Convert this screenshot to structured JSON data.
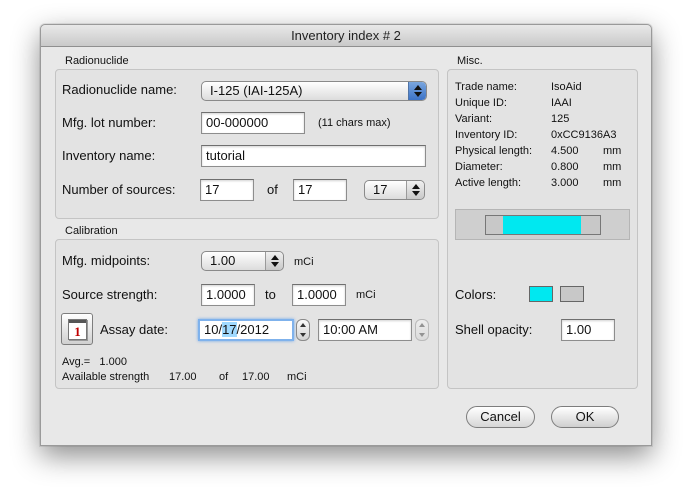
{
  "window": {
    "title": "Inventory index # 2"
  },
  "radionuclide": {
    "group_label": "Radionuclide",
    "name_label": "Radionuclide name:",
    "name_value": "I-125 (IAI-125A)",
    "lot_label": "Mfg. lot number:",
    "lot_value": "00-000000",
    "lot_hint": "(11 chars max)",
    "inventory_label": "Inventory name:",
    "inventory_value": "tutorial",
    "sources_label": "Number of sources:",
    "sources_value": "17",
    "of_label": "of",
    "sources_total": "17",
    "sources_popup": "17"
  },
  "calibration": {
    "group_label": "Calibration",
    "midpoints_label": "Mfg. midpoints:",
    "midpoints_value": "1.00",
    "midpoints_unit": "mCi",
    "strength_label": "Source strength:",
    "strength_from": "1.0000",
    "to_label": "to",
    "strength_to": "1.0000",
    "strength_unit": "mCi",
    "calendar_day": "1",
    "assay_label": "Assay date:",
    "date_month": "10/",
    "date_day": "17",
    "date_year": "/2012",
    "time_value": "10:00 AM",
    "avg_line": "Avg.=   1.000",
    "available_label": "Available strength",
    "available_value": "17.00",
    "available_of": "of",
    "available_total": "17.00",
    "available_unit": "mCi"
  },
  "misc": {
    "group_label": "Misc.",
    "rows": [
      {
        "label": "Trade name:",
        "value": "IsoAid",
        "unit": ""
      },
      {
        "label": "Unique ID:",
        "value": "IAAI",
        "unit": ""
      },
      {
        "label": "Variant:",
        "value": "125",
        "unit": ""
      },
      {
        "label": "Inventory ID:",
        "value": "0xCC9136A3",
        "unit": ""
      },
      {
        "label": "Physical length:",
        "value": "4.500",
        "unit": "mm"
      },
      {
        "label": "Diameter:",
        "value": "0.800",
        "unit": "mm"
      },
      {
        "label": "Active length:",
        "value": "3.000",
        "unit": "mm"
      }
    ],
    "colors_label": "Colors:",
    "active_color": "#00e8f0",
    "shell_color": "#c8c8c8",
    "opacity_label": "Shell opacity:",
    "opacity_value": "1.00"
  },
  "buttons": {
    "cancel": "Cancel",
    "ok": "OK"
  }
}
